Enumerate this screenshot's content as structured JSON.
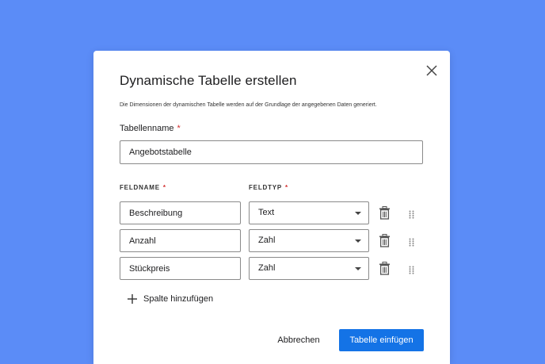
{
  "dialog": {
    "title": "Dynamische Tabelle erstellen",
    "description": "Die Dimensionen der dynamischen Tabelle werden auf der Grundlage der angegebenen Daten generiert.",
    "close_icon": "close-icon"
  },
  "table_name": {
    "label": "Tabellenname",
    "required_marker": "*",
    "value": "Angebotstabelle"
  },
  "columns": {
    "field_name_header": "FELDNAME",
    "field_type_header": "FELDTYP",
    "required_marker": "*",
    "rows": [
      {
        "name": "Beschreibung",
        "type": "Text"
      },
      {
        "name": "Anzahl",
        "type": "Zahl"
      },
      {
        "name": "Stückpreis",
        "type": "Zahl"
      }
    ],
    "row_icons": [
      "trash-icon",
      "drag-handle-icon"
    ]
  },
  "add_column": {
    "label": "Spalte hinzufügen",
    "icon": "plus-icon"
  },
  "footer": {
    "cancel_label": "Abbrechen",
    "submit_label": "Tabelle einfügen"
  },
  "colors": {
    "background": "#5b8cf7",
    "primary": "#1473e6",
    "required": "#d32f2f"
  }
}
